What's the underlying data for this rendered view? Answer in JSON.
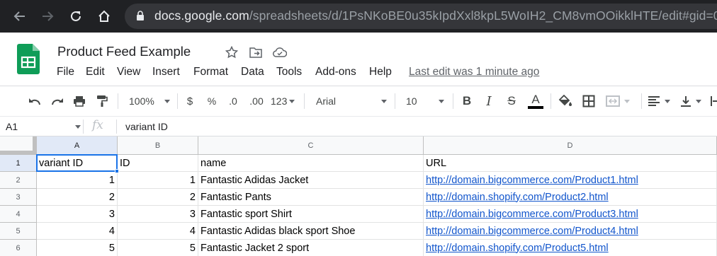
{
  "browser": {
    "url_host": "docs.google.com",
    "url_path": "/spreadsheets/d/1PsNKoBE0u35kIpdXxl8kpL5WoIH2_CM8vmOOikklHTE/edit#gid=0"
  },
  "document": {
    "title": "Product Feed Example",
    "last_edit": "Last edit was 1 minute ago"
  },
  "menu": {
    "file": "File",
    "edit": "Edit",
    "view": "View",
    "insert": "Insert",
    "format": "Format",
    "data": "Data",
    "tools": "Tools",
    "addons": "Add-ons",
    "help": "Help"
  },
  "toolbar": {
    "zoom": "100%",
    "currency": "$",
    "percent": "%",
    "decrease_decimal": ".0",
    "increase_decimal": ".00",
    "more_formats": "123",
    "font": "Arial",
    "font_size": "10",
    "bold": "B",
    "italic": "I",
    "strikethrough": "S",
    "text_color": "A"
  },
  "formula_bar": {
    "cell_ref": "A1",
    "fx": "fx",
    "value": "variant ID"
  },
  "grid": {
    "columns": [
      "A",
      "B",
      "C",
      "D"
    ],
    "rows": [
      {
        "num": "1",
        "a": "variant ID",
        "b": "ID",
        "c": "name",
        "d": "URL"
      },
      {
        "num": "2",
        "a": "1",
        "b": "1",
        "c": "Fantastic Adidas Jacket",
        "d": "http://domain.bigcommerce.com/Product1.html"
      },
      {
        "num": "3",
        "a": "2",
        "b": "2",
        "c": "Fantastic Pants",
        "d": "http://domain.shopify.com/Product2.html"
      },
      {
        "num": "4",
        "a": "3",
        "b": "3",
        "c": "Fantastic sport Shirt",
        "d": "http://domain.bigcommerce.com/Product3.html"
      },
      {
        "num": "5",
        "a": "4",
        "b": "4",
        "c": "Fantastic Adidas black sport Shoe",
        "d": "http://domain.bigcommerce.com/Product4.html"
      },
      {
        "num": "6",
        "a": "5",
        "b": "5",
        "c": "Fantastic Jacket 2 sport",
        "d": "http://domain.shopify.com/Product5.html"
      }
    ]
  },
  "colors": {
    "browser_bg": "#202124",
    "sheets_green": "#0f9d58",
    "selection_blue": "#1a73e8",
    "link_blue": "#1155cc"
  }
}
